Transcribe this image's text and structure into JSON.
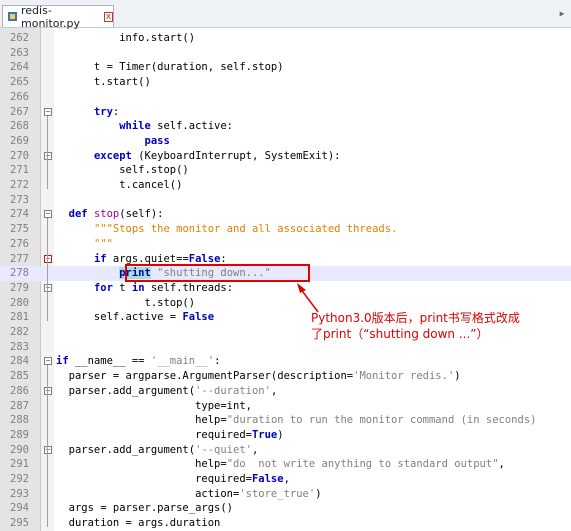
{
  "tab": {
    "filename": "redis-monitor.py",
    "close": "x"
  },
  "lines": [
    {
      "num": "262",
      "tokens": [
        {
          "t": "          info.start()"
        }
      ]
    },
    {
      "num": "263",
      "tokens": [
        {
          "t": ""
        }
      ]
    },
    {
      "num": "264",
      "tokens": [
        {
          "t": "      t = Timer(duration, self.stop)"
        }
      ]
    },
    {
      "num": "265",
      "tokens": [
        {
          "t": "      t.start()"
        }
      ]
    },
    {
      "num": "266",
      "tokens": [
        {
          "t": ""
        }
      ]
    },
    {
      "num": "267",
      "tokens": [
        {
          "t": "      "
        },
        {
          "t": "try",
          "c": "kw"
        },
        {
          "t": ":"
        }
      ]
    },
    {
      "num": "268",
      "tokens": [
        {
          "t": "          "
        },
        {
          "t": "while",
          "c": "kw"
        },
        {
          "t": " self.active:"
        }
      ]
    },
    {
      "num": "269",
      "tokens": [
        {
          "t": "              "
        },
        {
          "t": "pass",
          "c": "kw"
        }
      ]
    },
    {
      "num": "270",
      "tokens": [
        {
          "t": "      "
        },
        {
          "t": "except",
          "c": "kw"
        },
        {
          "t": " (KeyboardInterrupt, SystemExit):"
        }
      ]
    },
    {
      "num": "271",
      "tokens": [
        {
          "t": "          self.stop()"
        }
      ]
    },
    {
      "num": "272",
      "tokens": [
        {
          "t": "          t.cancel()"
        }
      ]
    },
    {
      "num": "273",
      "tokens": [
        {
          "t": ""
        }
      ]
    },
    {
      "num": "274",
      "tokens": [
        {
          "t": "  "
        },
        {
          "t": "def",
          "c": "kw"
        },
        {
          "t": " "
        },
        {
          "t": "stop",
          "c": "fn"
        },
        {
          "t": "(self):"
        }
      ]
    },
    {
      "num": "275",
      "tokens": [
        {
          "t": "      "
        },
        {
          "t": "\"\"\"Stops the monitor and all associated threads.",
          "c": "doc"
        }
      ]
    },
    {
      "num": "276",
      "tokens": [
        {
          "t": "      "
        },
        {
          "t": "\"\"\"",
          "c": "doc"
        }
      ]
    },
    {
      "num": "277",
      "tokens": [
        {
          "t": "      "
        },
        {
          "t": "if",
          "c": "kw"
        },
        {
          "t": " args.quiet=="
        },
        {
          "t": "False",
          "c": "kw"
        },
        {
          "t": ":"
        }
      ]
    },
    {
      "num": "278",
      "cur": true,
      "tokens": [
        {
          "t": "          "
        },
        {
          "t": "print",
          "c": "kw",
          "id": "print-hl"
        },
        {
          "t": " "
        },
        {
          "t": "\"shutting down...\"",
          "c": "str"
        }
      ]
    },
    {
      "num": "279",
      "tokens": [
        {
          "t": "      "
        },
        {
          "t": "for",
          "c": "kw"
        },
        {
          "t": " t "
        },
        {
          "t": "in",
          "c": "kw"
        },
        {
          "t": " self.threads:"
        }
      ]
    },
    {
      "num": "280",
      "tokens": [
        {
          "t": "              t.stop()"
        }
      ]
    },
    {
      "num": "281",
      "tokens": [
        {
          "t": "      self.active = "
        },
        {
          "t": "False",
          "c": "kw"
        }
      ]
    },
    {
      "num": "282",
      "tokens": [
        {
          "t": ""
        }
      ]
    },
    {
      "num": "283",
      "tokens": [
        {
          "t": ""
        }
      ]
    },
    {
      "num": "284",
      "tokens": [
        {
          "t": ""
        },
        {
          "t": "if",
          "c": "kw"
        },
        {
          "t": " __name__ == "
        },
        {
          "t": "'__main__'",
          "c": "str"
        },
        {
          "t": ":"
        }
      ]
    },
    {
      "num": "285",
      "tokens": [
        {
          "t": "  parser = argparse.ArgumentParser(description="
        },
        {
          "t": "'Monitor redis.'",
          "c": "str"
        },
        {
          "t": ")"
        }
      ]
    },
    {
      "num": "286",
      "tokens": [
        {
          "t": "  parser.add_argument("
        },
        {
          "t": "'--duration'",
          "c": "str"
        },
        {
          "t": ","
        }
      ]
    },
    {
      "num": "287",
      "tokens": [
        {
          "t": "                      type=int,"
        }
      ]
    },
    {
      "num": "288",
      "tokens": [
        {
          "t": "                      help="
        },
        {
          "t": "\"duration to run the monitor command (in seconds)",
          "c": "str"
        }
      ]
    },
    {
      "num": "289",
      "tokens": [
        {
          "t": "                      required="
        },
        {
          "t": "True",
          "c": "kw"
        },
        {
          "t": ")"
        }
      ]
    },
    {
      "num": "290",
      "tokens": [
        {
          "t": "  parser.add_argument("
        },
        {
          "t": "'--quiet'",
          "c": "str"
        },
        {
          "t": ","
        }
      ]
    },
    {
      "num": "291",
      "tokens": [
        {
          "t": "                      help="
        },
        {
          "t": "\"do  not write anything to standard output\"",
          "c": "str"
        },
        {
          "t": ","
        }
      ]
    },
    {
      "num": "292",
      "tokens": [
        {
          "t": "                      required="
        },
        {
          "t": "False",
          "c": "kw"
        },
        {
          "t": ","
        }
      ]
    },
    {
      "num": "293",
      "tokens": [
        {
          "t": "                      action="
        },
        {
          "t": "'store_true'",
          "c": "str"
        },
        {
          "t": ")"
        }
      ]
    },
    {
      "num": "294",
      "tokens": [
        {
          "t": "  args = parser.parse_args()"
        }
      ]
    },
    {
      "num": "295",
      "tokens": [
        {
          "t": "  duration = args.duration"
        }
      ]
    }
  ],
  "annotation": {
    "line1": "Python3.0版本后，print书写格式改成",
    "line2": "了print（“shutting down ...”）"
  },
  "colors": {
    "highlight_box": "#e00000",
    "keyword": "#0000c0",
    "string": "#808080",
    "docstring": "#e08000"
  }
}
